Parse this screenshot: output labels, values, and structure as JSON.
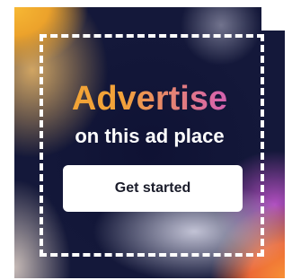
{
  "ad": {
    "headline": "Advertise",
    "subheadline": "on this ad place",
    "cta_label": "Get started"
  }
}
